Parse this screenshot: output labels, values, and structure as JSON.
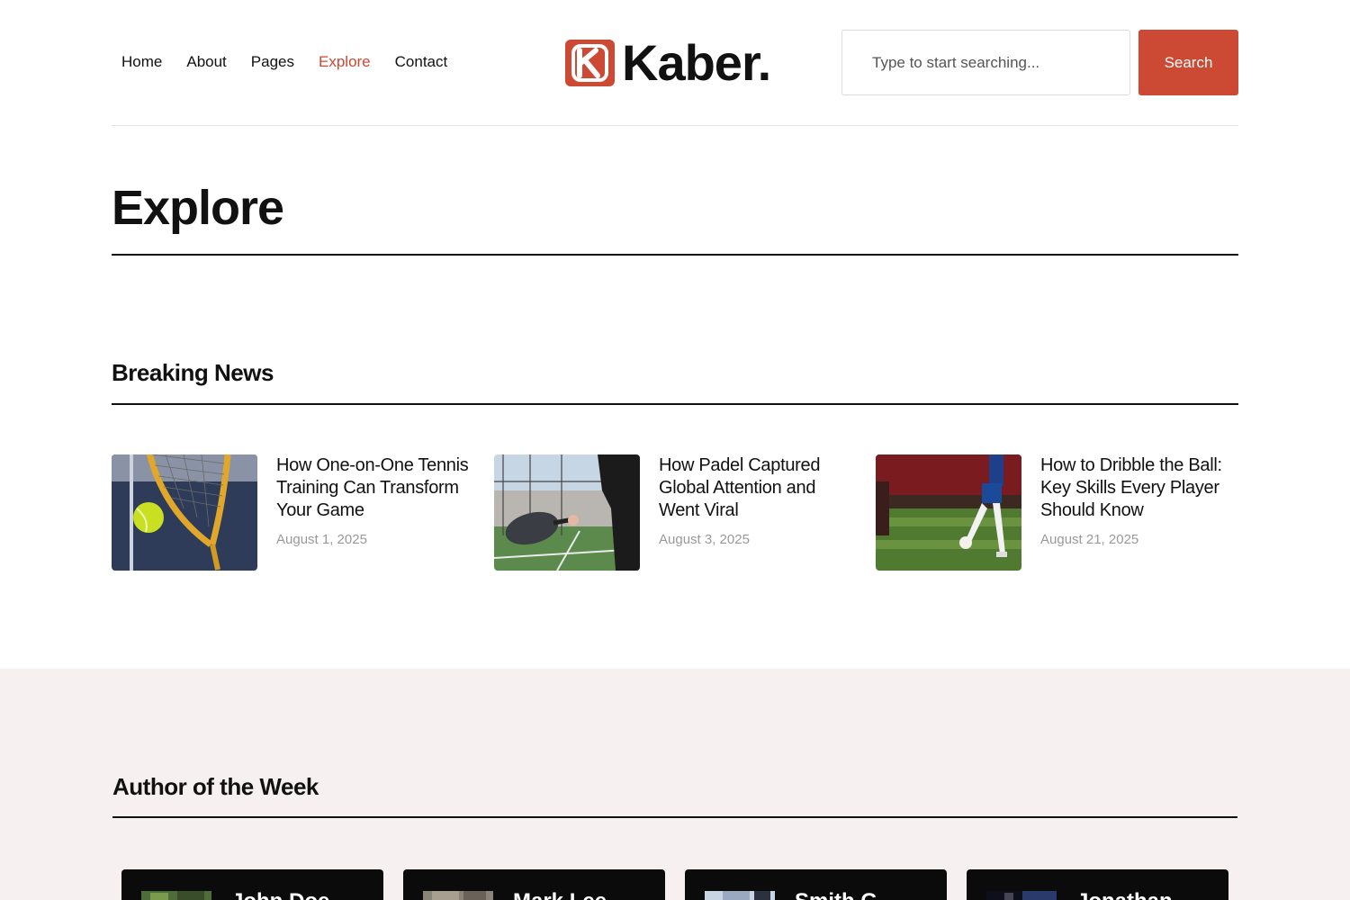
{
  "nav": {
    "items": [
      {
        "label": "Home"
      },
      {
        "label": "About"
      },
      {
        "label": "Pages"
      },
      {
        "label": "Explore"
      },
      {
        "label": "Contact"
      }
    ],
    "active": "Explore"
  },
  "brand": {
    "name": "Kaber.",
    "logo_icon": "kaber-logo-icon",
    "accent": "#cc4a33"
  },
  "search": {
    "placeholder": "Type to start searching...",
    "value": "",
    "button_label": "Search"
  },
  "page": {
    "title": "Explore"
  },
  "breaking_news": {
    "title": "Breaking News",
    "articles": [
      {
        "title": "How One-on-One Tennis Training Can Transform Your Game",
        "date": "August 1, 2025"
      },
      {
        "title": "How Padel Captured Global Attention and Went Viral",
        "date": "August 3, 2025"
      },
      {
        "title": "How to Dribble the Ball: Key Skills Every Player Should Know",
        "date": "August 21, 2025"
      }
    ]
  },
  "authors": {
    "title": "Author of the Week",
    "items": [
      {
        "name": "John Doe"
      },
      {
        "name": "Mark Lee"
      },
      {
        "name": "Smith G"
      },
      {
        "name": "Jonathan"
      }
    ]
  }
}
